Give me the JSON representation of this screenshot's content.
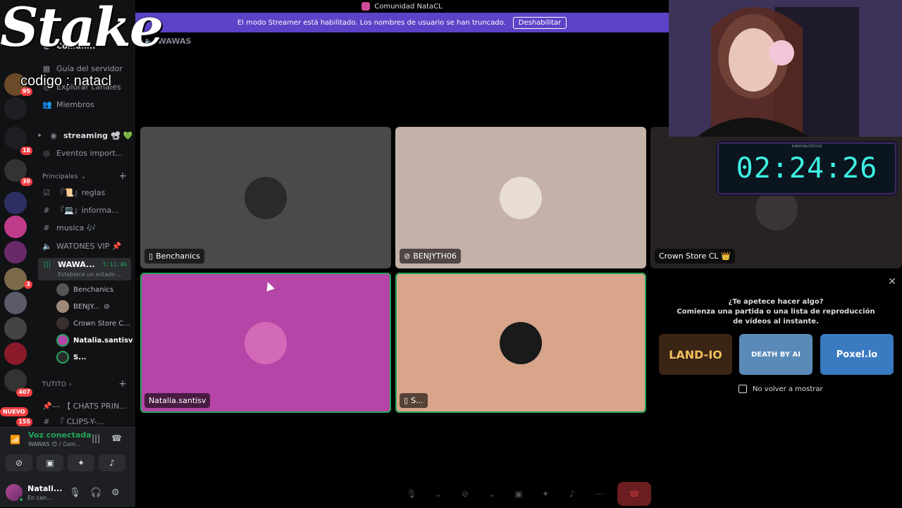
{
  "window": {
    "title": "Comunidad NataCL"
  },
  "banner": {
    "text": "El modo Streamer está habilitado. Los nombres de usuario se han truncado.",
    "button": "Deshabilitar"
  },
  "channel_header": {
    "name": "WAWAS"
  },
  "rail": {
    "badges": [
      "95",
      "18",
      "39",
      "3",
      "407",
      "155"
    ],
    "nuevo": "NUEVO"
  },
  "sidebar": {
    "server_name": "Comun...",
    "nav": [
      {
        "label": "Guía del servidor",
        "icon": "map-icon"
      },
      {
        "label": "Explorar canales",
        "icon": "compass-icon"
      },
      {
        "label": "Miembros",
        "icon": "members-icon"
      }
    ],
    "streaming": "streaming 📽 💚",
    "eventos": "Eventos import...",
    "cat_principales": "Principales",
    "channels": [
      {
        "label": "『📜』reglas",
        "icon": "rules-icon"
      },
      {
        "label": "『💻』informa...",
        "icon": "hash-icon"
      },
      {
        "label": "musica 🎶",
        "icon": "hash-icon"
      },
      {
        "label": "WATONES VIP 📌",
        "icon": "speaker-icon"
      }
    ],
    "voice_channel": {
      "name": "WAWA...",
      "time": "5:11:46",
      "status": "Establece un estado ..."
    },
    "voice_users": [
      "Benchanics",
      "BENJY...",
      "Crown Store C...",
      "Natalia.santisv",
      "S..."
    ],
    "cat_tutito": "TUTITO",
    "more_channels": [
      "📌--- 【 CHATS PRIN...",
      "『 CLIPS-Y-..."
    ]
  },
  "voice_panel": {
    "connected": "Voz conectada",
    "where": "WAWAS 😊 / Com..."
  },
  "user": {
    "name": "Natali...",
    "status": "En can..."
  },
  "tiles": [
    {
      "name": "Benchanics",
      "bg": "#4a4a4a"
    },
    {
      "name": "BENJYTH06",
      "bg": "#c4b2a8"
    },
    {
      "name": "Crown Store CL 👑",
      "bg": "#262322"
    },
    {
      "name": "Natalia.santisv",
      "bg": "#b545a6"
    },
    {
      "name": "S...",
      "bg": "#d8a58a"
    }
  ],
  "activity": {
    "question": "¿Te apetece hacer algo?",
    "subtitle": "Comienza una partida o una lista de reproducción de vídeos al instante.",
    "games": [
      "LAND-IO",
      "DEATH BY AI",
      "Poxel.io"
    ],
    "checkbox": "No volver a mostrar"
  },
  "timer": {
    "value": "02:24:26",
    "caption": "EUNATHON FESTIVOS"
  },
  "overlay": {
    "brand": "Stake",
    "code": "codigo : natacl",
    "crown_logo": "Crown"
  },
  "colors": {
    "banner": "#5d43c8",
    "green": "#23a55a",
    "timer": "#3ef2e4"
  }
}
